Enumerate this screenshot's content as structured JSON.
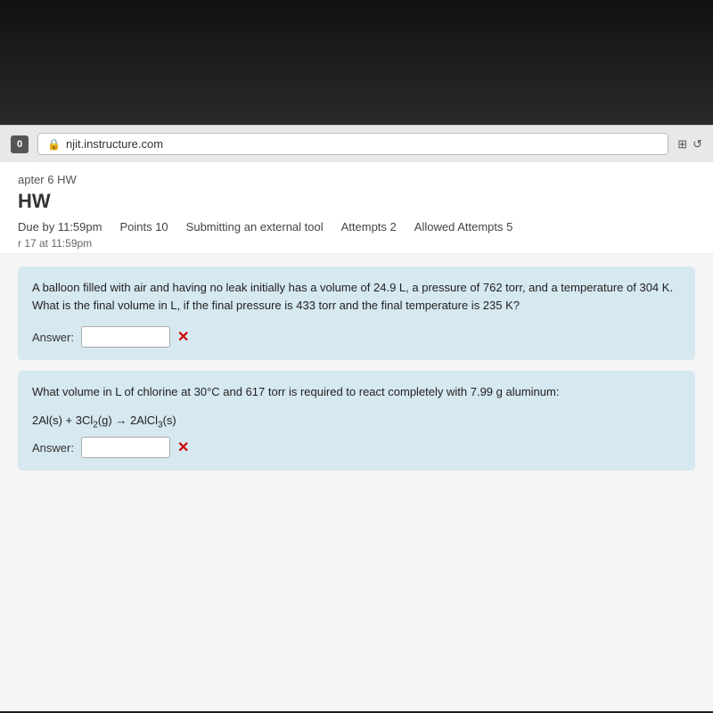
{
  "browser": {
    "url": "njit.instructure.com",
    "reload_label": "↺"
  },
  "breadcrumb": "apter 6 HW",
  "page_title": "HW",
  "assignment_meta": {
    "due_label": "by 11:59pm",
    "points_label": "Points",
    "points_value": "10",
    "submitting_label": "Submitting",
    "submitting_value": "an external tool",
    "attempts_label": "Attempts",
    "attempts_value": "2",
    "allowed_attempts_label": "Allowed Attempts",
    "allowed_attempts_value": "5"
  },
  "due_date": "r 17 at 11:59pm",
  "questions": [
    {
      "id": "q1",
      "text": "A balloon filled with air and having no leak initially has a volume of 24.9 L, a pressure of 762 torr, and a temperature of 304 K.\nWhat is the final volume in L, if the final pressure is 433 torr and the final temperature is 235 K?",
      "answer_label": "Answer:",
      "answer_value": ""
    },
    {
      "id": "q2",
      "text": "What volume in L of chlorine at 30°C and 617 torr is required to react completely with 7.99 g aluminum:",
      "reaction": "2Al(s) + 3Cl₂(g) → 2AlCl₃(s)",
      "answer_label": "Answer:",
      "answer_value": ""
    }
  ],
  "ui": {
    "answer_label": "Answer:",
    "x_mark": "✕"
  }
}
